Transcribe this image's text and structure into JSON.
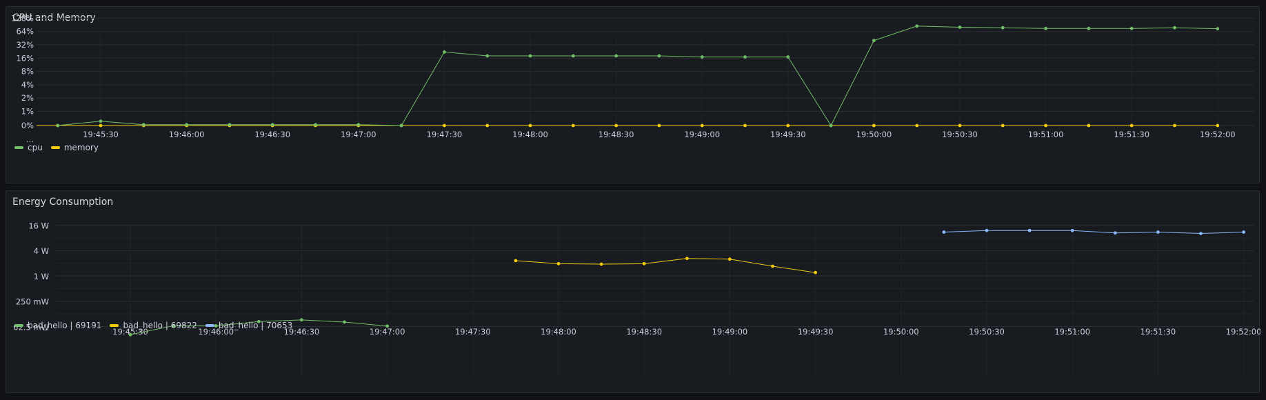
{
  "panels": [
    {
      "title": "CPU and Memory"
    },
    {
      "title": "Energy Consumption"
    }
  ],
  "chart_data": [
    {
      "type": "line",
      "title": "CPU and Memory",
      "x_tick_labels": [
        "19:45:30",
        "19:46:00",
        "19:46:30",
        "19:47:00",
        "19:47:30",
        "19:48:00",
        "19:48:30",
        "19:49:00",
        "19:49:30",
        "19:50:00",
        "19:50:30",
        "19:51:00",
        "19:51:30",
        "19:52:00"
      ],
      "y_tick_labels": [
        "128%",
        "64%",
        "32%",
        "16%",
        "8%",
        "4%",
        "2%",
        "1%",
        "0%",
        "..."
      ],
      "y_scale": "symlog",
      "grid": true,
      "legend_placement": "bottom-left",
      "x": [
        "19:45:15",
        "19:45:30",
        "19:45:45",
        "19:46:00",
        "19:46:15",
        "19:46:30",
        "19:46:45",
        "19:47:00",
        "19:47:15",
        "19:47:30",
        "19:47:45",
        "19:48:00",
        "19:48:15",
        "19:48:30",
        "19:48:45",
        "19:49:00",
        "19:49:15",
        "19:49:30",
        "19:49:45",
        "19:50:00",
        "19:50:15",
        "19:50:30",
        "19:50:45",
        "19:51:00",
        "19:51:15",
        "19:51:30",
        "19:51:45",
        "19:52:00"
      ],
      "series": [
        {
          "name": "cpu",
          "color": "#73bf69",
          "values": [
            null,
            0,
            0.6,
            0.5,
            0.5,
            0.5,
            0.5,
            0.5,
            0.5,
            0,
            22,
            18,
            18,
            18,
            18,
            18,
            17,
            17,
            17,
            0,
            40,
            85,
            80,
            78,
            75,
            75,
            75,
            78,
            74
          ]
        },
        {
          "name": "memory",
          "color": "#f2cc0c",
          "values": [
            null,
            0,
            0,
            0,
            0,
            0,
            0,
            0,
            0,
            0,
            0,
            0,
            0,
            0,
            0,
            0,
            0,
            0,
            0,
            0,
            0,
            0,
            0,
            0,
            0,
            0,
            0,
            0,
            0
          ]
        }
      ]
    },
    {
      "type": "line",
      "title": "Energy Consumption",
      "x_tick_labels": [
        "19:45:30",
        "19:46:00",
        "19:46:30",
        "19:47:00",
        "19:47:30",
        "19:48:00",
        "19:48:30",
        "19:49:00",
        "19:49:30",
        "19:50:00",
        "19:50:30",
        "19:51:00",
        "19:51:30",
        "19:52:00"
      ],
      "y_tick_labels": [
        "16 W",
        "4 W",
        "1 W",
        "250 mW",
        "62.5 mW"
      ],
      "y_scale": "log",
      "grid": true,
      "legend_placement": "bottom-left",
      "series": [
        {
          "name": "bad_hello | 69191",
          "color": "#73bf69",
          "points": [
            [
              "19:45:30",
              0.04
            ],
            [
              "19:45:45",
              0.065
            ],
            [
              "19:46:00",
              0.065
            ],
            [
              "19:46:15",
              0.082
            ],
            [
              "19:46:30",
              0.09
            ],
            [
              "19:46:45",
              0.08
            ],
            [
              "19:47:00",
              0.064
            ]
          ]
        },
        {
          "name": "bad_hello | 69822",
          "color": "#f2cc0c",
          "points": [
            [
              "19:47:45",
              2.3
            ],
            [
              "19:48:00",
              1.95
            ],
            [
              "19:48:15",
              1.9
            ],
            [
              "19:48:30",
              1.95
            ],
            [
              "19:48:45",
              2.6
            ],
            [
              "19:49:00",
              2.5
            ],
            [
              "19:49:15",
              1.7
            ],
            [
              "19:49:30",
              1.2
            ]
          ]
        },
        {
          "name": "bad_hello | 70653",
          "color": "#8ab8ff",
          "points": [
            [
              "19:50:15",
              11
            ],
            [
              "19:50:30",
              12
            ],
            [
              "19:50:45",
              12
            ],
            [
              "19:51:00",
              12
            ],
            [
              "19:51:15",
              10.5
            ],
            [
              "19:51:30",
              11
            ],
            [
              "19:51:45",
              10.2
            ],
            [
              "19:52:00",
              11
            ]
          ]
        }
      ]
    }
  ]
}
